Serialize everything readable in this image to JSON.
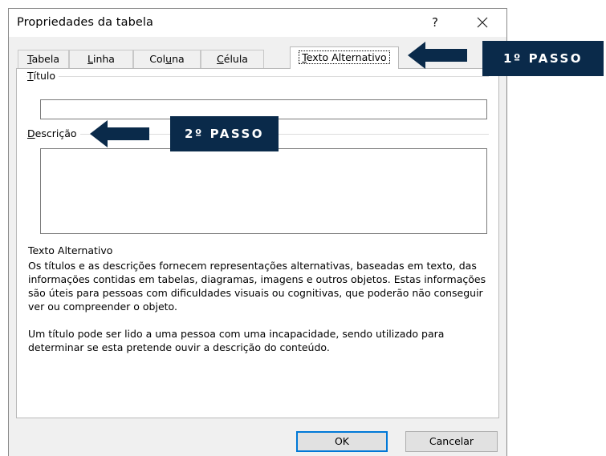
{
  "dialog": {
    "title": "Propriedades da tabela",
    "help_label": "?",
    "close_icon": "close-icon"
  },
  "tabs": [
    {
      "label": "Tabela",
      "accel": "T",
      "rest": "abela",
      "active": false
    },
    {
      "label": "Linha",
      "accel": "L",
      "rest": "inha",
      "active": false
    },
    {
      "label": "Coluna",
      "pre": "Col",
      "accel": "u",
      "rest": "na",
      "active": false
    },
    {
      "label": "Célula",
      "accel": "C",
      "rest": "élula",
      "active": false
    },
    {
      "label": "Texto Alternativo",
      "accel": "T",
      "rest": "exto Alternativo",
      "active": true
    }
  ],
  "fields": {
    "titulo": {
      "accel": "T",
      "rest": "ítulo",
      "value": ""
    },
    "descricao": {
      "accel": "D",
      "rest": "escrição",
      "value": ""
    }
  },
  "help": {
    "heading": "Texto Alternativo",
    "para1": "Os títulos e as descrições fornecem representações alternativas, baseadas em texto, das informações contidas em tabelas, diagramas, imagens e outros objetos. Estas informações são úteis para pessoas com dificuldades visuais ou cognitivas, que poderão não conseguir ver ou compreender o objeto.",
    "para2": "Um título pode ser lido a uma pessoa com uma incapacidade, sendo utilizado para determinar se esta pretende ouvir a descrição do conteúdo."
  },
  "buttons": {
    "ok": "OK",
    "cancel": "Cancelar"
  },
  "callouts": {
    "step1": "1º PASSO",
    "step2": "2º PASSO",
    "color": "#0a2a4a"
  }
}
